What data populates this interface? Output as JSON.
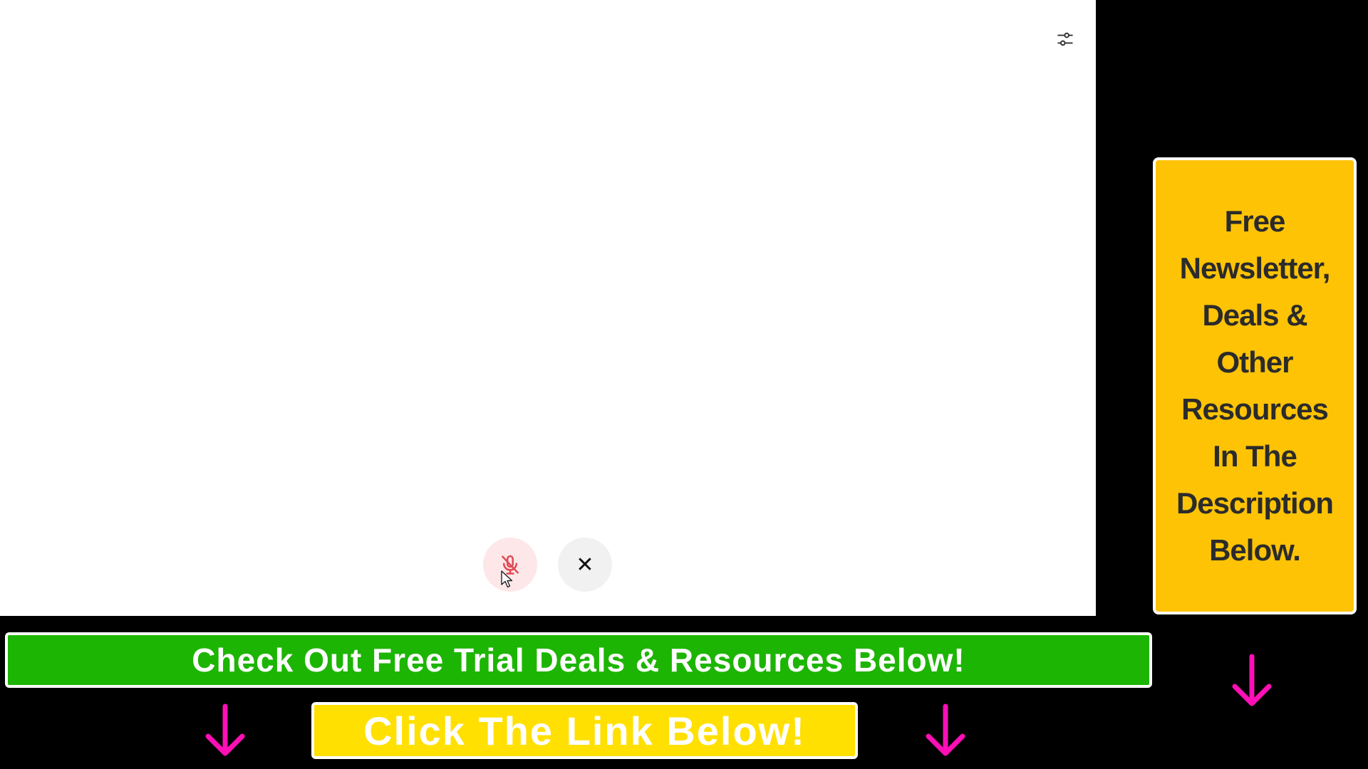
{
  "app": {
    "settings_icon": "sliders-icon",
    "mic_button_icon": "microphone-muted-icon",
    "close_button_icon": "close-icon",
    "close_glyph": "✕",
    "colors": {
      "panel_background": "#ffffff",
      "mic_button_bg": "#fde7e8",
      "mic_icon": "#e04a55",
      "close_button_bg": "#f1f1f1"
    }
  },
  "overlay": {
    "side_panel_lines": [
      "Free",
      "Newsletter,",
      "Deals &",
      "Other",
      "Resources",
      "In The",
      "Description",
      "Below."
    ],
    "green_banner_text": "Check Out Free Trial Deals & Resources Below!",
    "yellow_banner_text": "Click The Link Below!",
    "arrow_icon": "arrow-down-icon",
    "colors": {
      "side_panel_bg": "#fec305",
      "green_banner_bg": "#1db504",
      "yellow_banner_bg": "#ffe000",
      "arrow": "#ff0fb5"
    }
  }
}
